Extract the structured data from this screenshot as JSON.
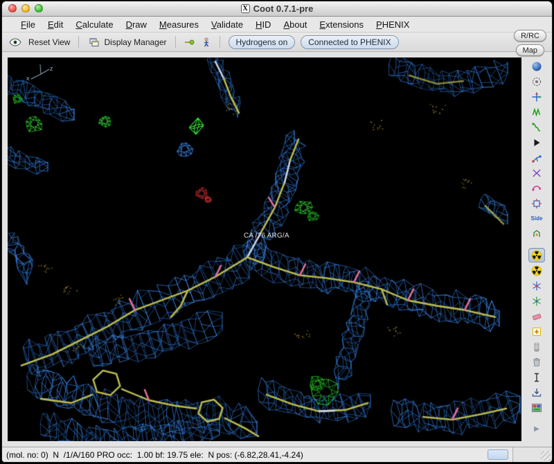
{
  "window": {
    "title": "Coot 0.7.1-pre"
  },
  "icons": {
    "x11_logo": "X",
    "overflow_arrow": "▶"
  },
  "menubar": {
    "items": [
      "File",
      "Edit",
      "Calculate",
      "Draw",
      "Measures",
      "Validate",
      "HID",
      "About",
      "Extensions",
      "PHENIX"
    ]
  },
  "toolbar": {
    "reset_view_label": "Reset View",
    "display_manager_label": "Display Manager",
    "hydrogens_label": "Hydrogens on",
    "phenix_label": "Connected to PHENIX"
  },
  "corner_buttons": {
    "rrc_label": "R/RC",
    "map_label": "Map"
  },
  "scene": {
    "atom_label": "CA /76 ARG/A",
    "axis_x": "x",
    "axis_z": "z",
    "colors": {
      "mesh_blue": "#2d7ce0",
      "mesh_blue_light": "#3f8cf2",
      "model_yellow": "#b9b94e",
      "model_light": "#c9d3e4",
      "oxygen_pink": "#e0709a",
      "diff_green": "#1db41d",
      "diff_green_bright": "#38e038",
      "diff_red": "#cc3030",
      "water_dots": "#a08c28"
    }
  },
  "right_toolbar": {
    "items": [
      {
        "name": "view-sphere",
        "icon": "sphere"
      },
      {
        "name": "rotate-view",
        "icon": "orbit"
      },
      {
        "name": "translate-view",
        "icon": "axes"
      },
      {
        "name": "regularize-zone",
        "icon": "spring"
      },
      {
        "name": "refine-zone",
        "icon": "spring2"
      },
      {
        "name": "run-refinement",
        "icon": "triangle"
      },
      {
        "name": "auto-fit-rotamer",
        "icon": "rotamer"
      },
      {
        "name": "edit-chi-angles",
        "icon": "chi"
      },
      {
        "name": "flip-peptide",
        "icon": "flip"
      },
      {
        "name": "rotate-translate-zone",
        "icon": "rottrans"
      },
      {
        "name": "side-chain-180",
        "icon": "side-label",
        "label": "Side"
      },
      {
        "name": "mutate-residue",
        "icon": "mutate"
      },
      {
        "name": "map-molecule-toggle",
        "icon": "radioactive",
        "selected": true,
        "gap": true
      },
      {
        "name": "map-tool",
        "icon": "radioactive"
      },
      {
        "name": "add-terminal-residue",
        "icon": "jack"
      },
      {
        "name": "place-atom",
        "icon": "jack2"
      },
      {
        "name": "clear-atom",
        "icon": "eraser"
      },
      {
        "name": "add-residue",
        "icon": "plussq"
      },
      {
        "name": "undo-column",
        "icon": "column"
      },
      {
        "name": "delete-item",
        "icon": "trash"
      },
      {
        "name": "insert-text",
        "icon": "ibeam"
      },
      {
        "name": "accept-dialog",
        "icon": "tray"
      },
      {
        "name": "sequence-view",
        "icon": "picture"
      },
      {
        "name": "toolbar-overflow",
        "icon": "overflow",
        "gap": true
      }
    ]
  },
  "statusbar": {
    "text": "(mol. no: 0)  N  /1/A/160 PRO occ:  1.00 bf: 19.75 ele:  N pos: (-6.82,28.41,-4.24)"
  }
}
